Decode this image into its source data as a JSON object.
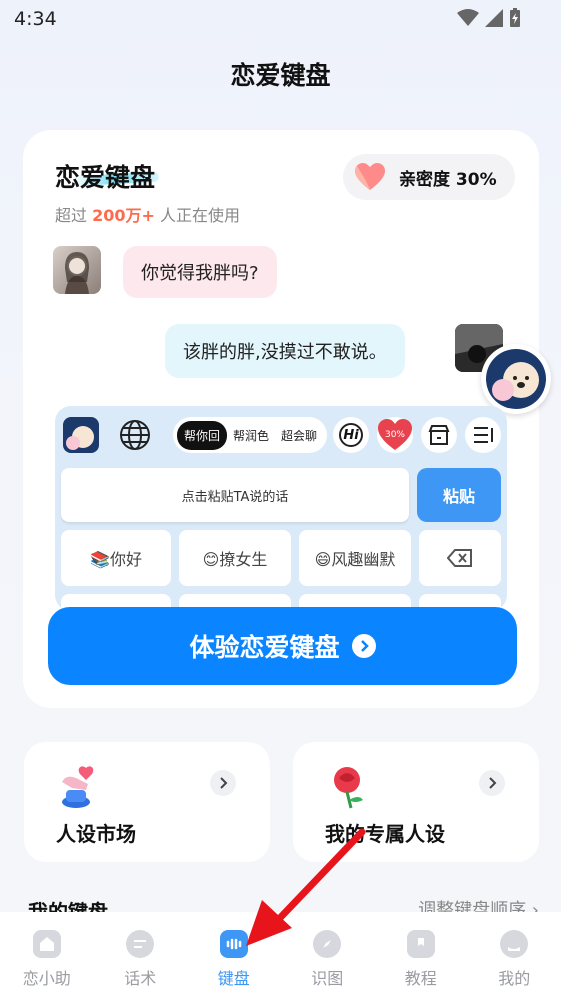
{
  "status_bar": {
    "time": "4:34"
  },
  "header": {
    "title": "恋爱键盘"
  },
  "card": {
    "title": "恋爱键盘",
    "subtitle_prefix": "超过",
    "subtitle_highlight": "200万+",
    "subtitle_suffix": "人正在使用",
    "intimacy_label": "亲密度 30%",
    "chat_left": "你觉得我胖吗?",
    "chat_right": "该胖的胖,没摸过不敢说。"
  },
  "keyboard_preview": {
    "modes": [
      "帮你回",
      "帮润色",
      "超会聊"
    ],
    "hi_label": "Hi",
    "heart_percent": "30%",
    "paste_placeholder": "点击粘贴TA说的话",
    "paste_button": "粘贴",
    "phrases": [
      "📚你好",
      "😊撩女生",
      "😄风趣幽默"
    ]
  },
  "cta": {
    "label": "体验恋爱键盘"
  },
  "features": [
    {
      "title": "人设市场"
    },
    {
      "title": "我的专属人设"
    }
  ],
  "my_keyboard": {
    "title": "我的键盘",
    "adjust_link": "调整键盘顺序 ›"
  },
  "bottom_nav": [
    {
      "label": "恋小助",
      "icon": "home-icon"
    },
    {
      "label": "话术",
      "icon": "chat-icon"
    },
    {
      "label": "键盘",
      "icon": "keyboard-icon",
      "active": true
    },
    {
      "label": "识图",
      "icon": "compass-icon"
    },
    {
      "label": "教程",
      "icon": "book-icon"
    },
    {
      "label": "我的",
      "icon": "profile-icon"
    }
  ],
  "colors": {
    "accent": "#0a84ff",
    "highlight": "#ff6a4d",
    "annotation_arrow": "#e8141c"
  }
}
